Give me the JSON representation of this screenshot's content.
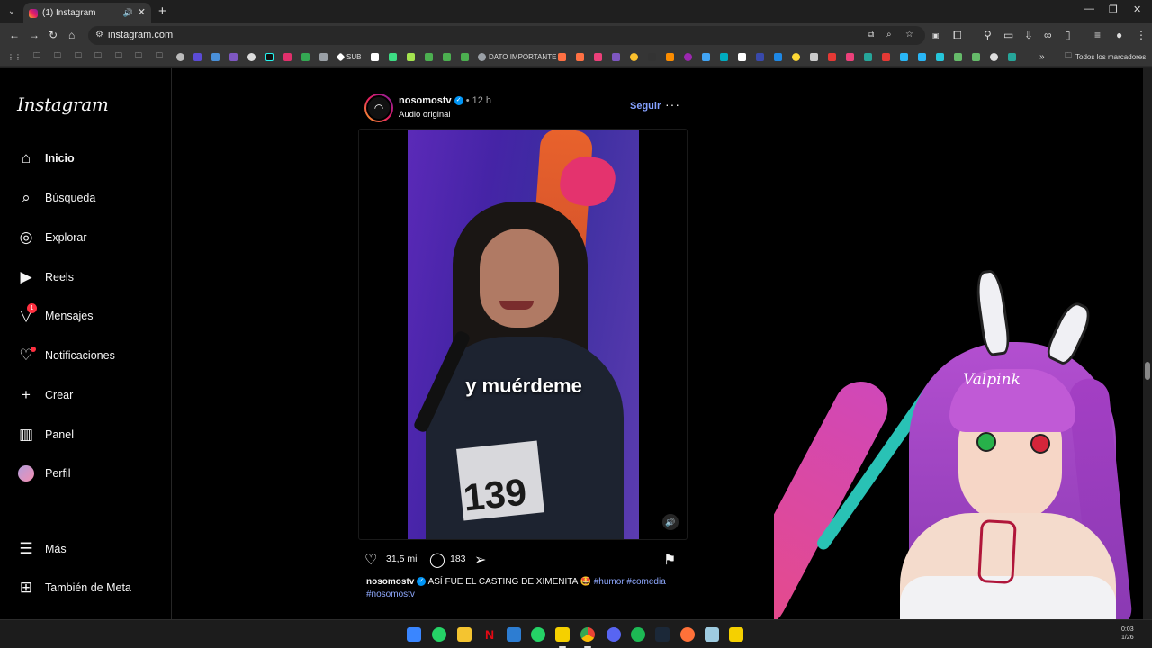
{
  "browser": {
    "tab_title": "(1) Instagram",
    "url": "instagram.com",
    "bookmarks": [
      {
        "label": "SUB",
        "color": "#ffffff"
      },
      {
        "label": "DATO IMPORTANTE",
        "color": "#9aa0a6"
      }
    ],
    "all_bookmarks_label": "Todos los marcadores"
  },
  "instagram": {
    "logo": "Instagram",
    "nav": [
      {
        "label": "Inicio",
        "icon": "home-icon"
      },
      {
        "label": "Búsqueda",
        "icon": "search-icon"
      },
      {
        "label": "Explorar",
        "icon": "compass-icon"
      },
      {
        "label": "Reels",
        "icon": "reels-icon"
      },
      {
        "label": "Mensajes",
        "icon": "messenger-icon",
        "badge": "1"
      },
      {
        "label": "Notificaciones",
        "icon": "heart-icon"
      },
      {
        "label": "Crear",
        "icon": "plus-icon"
      },
      {
        "label": "Panel",
        "icon": "chart-icon"
      },
      {
        "label": "Perfil",
        "icon": "avatar-icon"
      }
    ],
    "more_label": "Más",
    "meta_label": "También de Meta"
  },
  "post": {
    "username": "nosomostv",
    "time": "12 h",
    "audio": "Audio original",
    "follow_label": "Seguir",
    "overlay_caption": "y muérdeme",
    "bib_number": "139",
    "likes": "31,5 mil",
    "comments": "183",
    "caption_user": "nosomostv",
    "caption_text": "ASÍ FUE EL CASTING DE XIMENITA 🤩",
    "hashtags": [
      "#humor",
      "#comedia",
      "#nosomostv"
    ]
  },
  "overlay": {
    "vtuber_text": "Valpink"
  },
  "taskbar": {
    "clock_time": "0:03",
    "clock_date": "1/26"
  }
}
